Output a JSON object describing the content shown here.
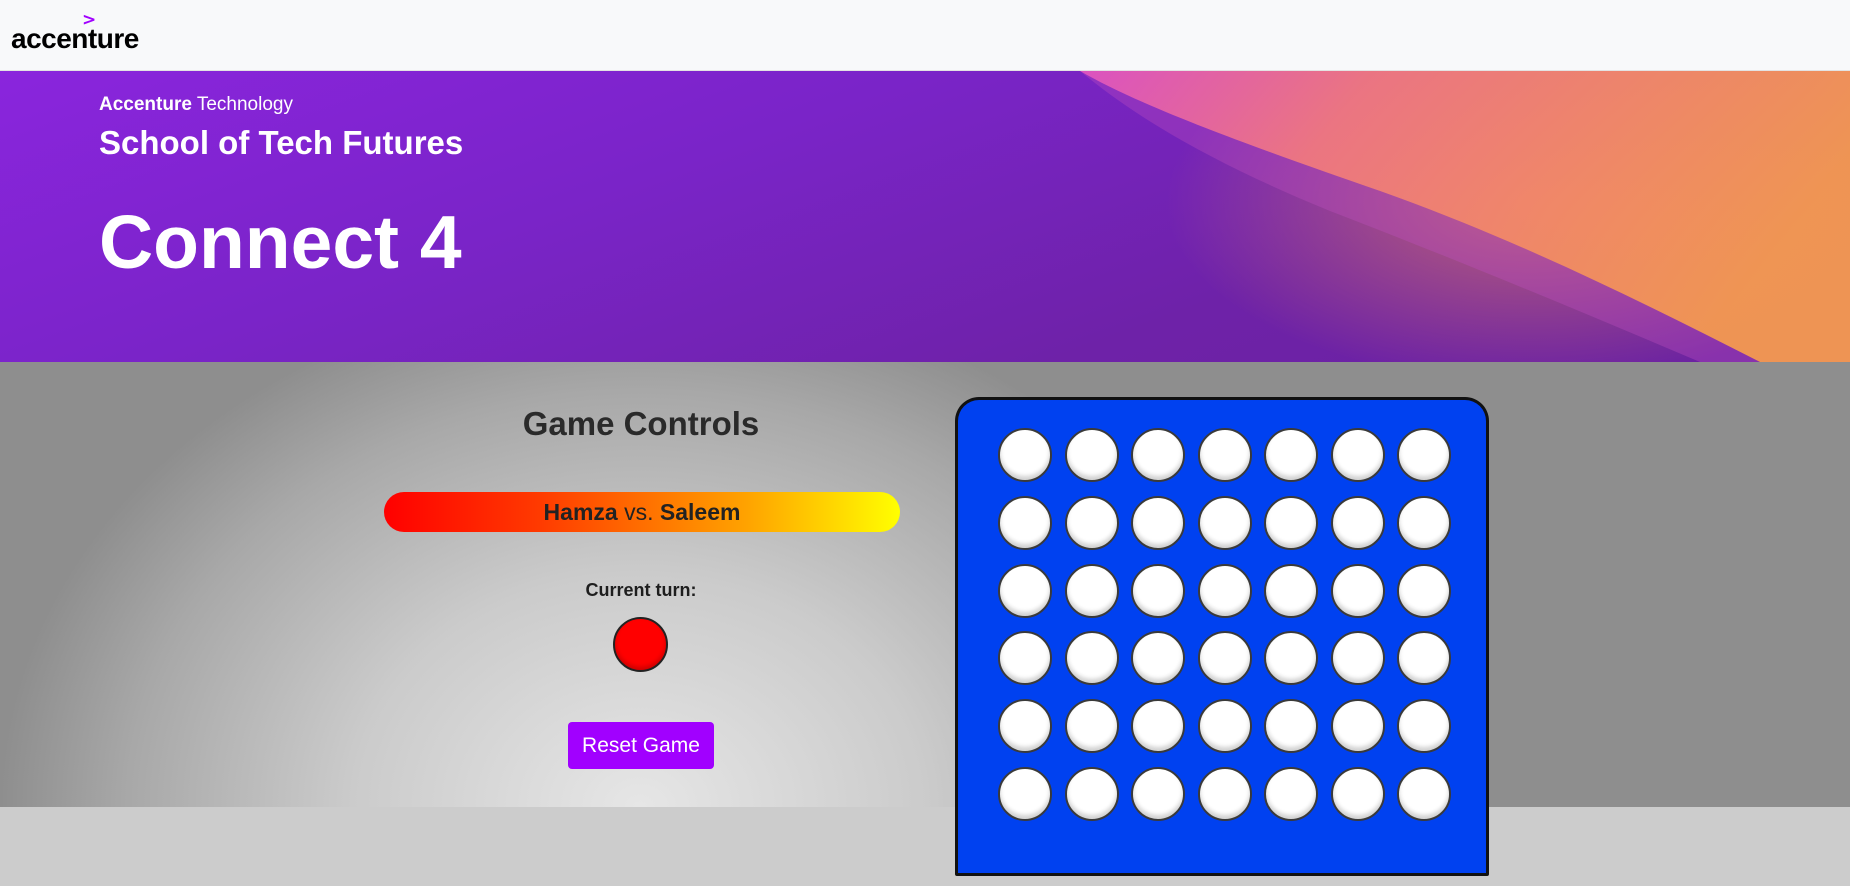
{
  "navbar": {
    "logo_mark": ">",
    "logo_text": "accenture"
  },
  "hero": {
    "eyebrow_brand": "Accenture",
    "eyebrow_rest": "Technology",
    "subtitle": "School of Tech Futures",
    "title": "Connect 4"
  },
  "controls": {
    "title": "Game Controls",
    "player1": "Hamza",
    "vs": "vs.",
    "player2": "Saleem",
    "turn_label": "Current turn:",
    "current_turn_color": "#ff0000",
    "reset_label": "Reset Game"
  },
  "board": {
    "rows": 6,
    "cols": 7,
    "board_color": "#0041f0",
    "empty_color": "#ffffff",
    "cells": [
      [
        "empty",
        "empty",
        "empty",
        "empty",
        "empty",
        "empty",
        "empty"
      ],
      [
        "empty",
        "empty",
        "empty",
        "empty",
        "empty",
        "empty",
        "empty"
      ],
      [
        "empty",
        "empty",
        "empty",
        "empty",
        "empty",
        "empty",
        "empty"
      ],
      [
        "empty",
        "empty",
        "empty",
        "empty",
        "empty",
        "empty",
        "empty"
      ],
      [
        "empty",
        "empty",
        "empty",
        "empty",
        "empty",
        "empty",
        "empty"
      ],
      [
        "empty",
        "empty",
        "empty",
        "empty",
        "empty",
        "empty",
        "empty"
      ]
    ]
  },
  "colors": {
    "accent": "#a100ff",
    "player1": "#ff0000",
    "player2": "#ffff00"
  }
}
